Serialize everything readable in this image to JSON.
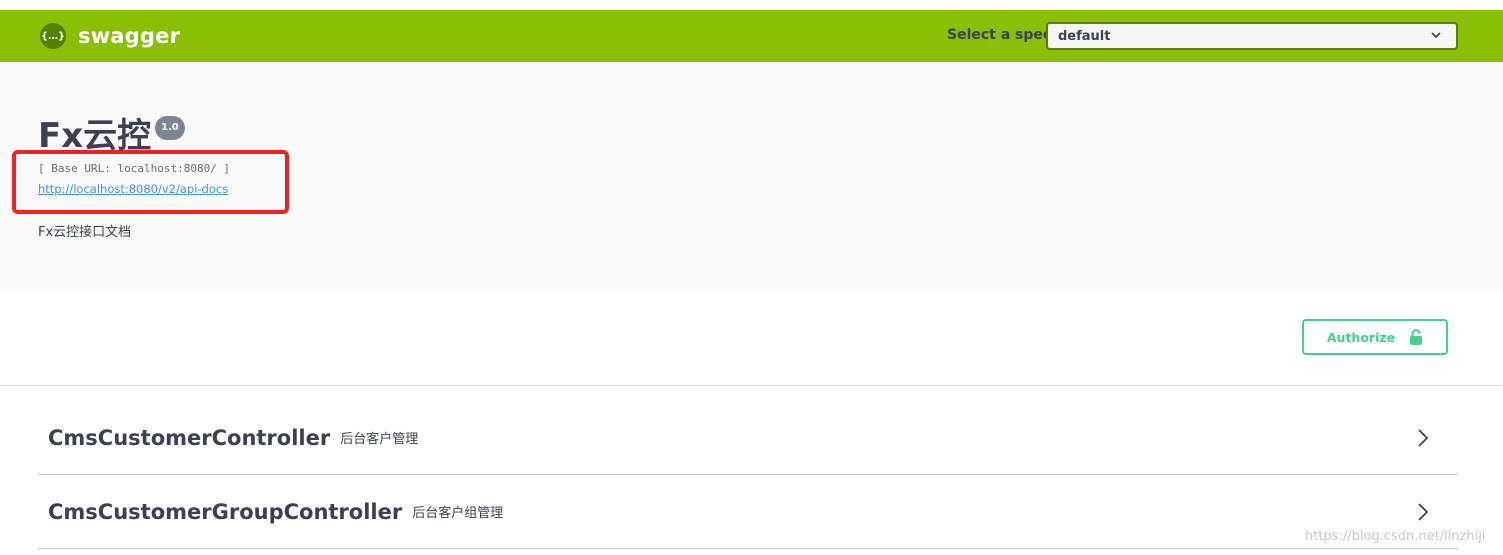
{
  "topbar": {
    "brand": "swagger",
    "logo_glyph": "{…}",
    "spec_label": "Select a spec",
    "spec_value": "default"
  },
  "info": {
    "title": "Fx云控",
    "version": "1.0",
    "base_url": "[ Base URL: localhost:8080/ ]",
    "docs_link": "http://localhost:8080/v2/api-docs",
    "description": "Fx云控接口文档"
  },
  "authorize": {
    "label": "Authorize"
  },
  "tags": [
    {
      "name": "CmsCustomerController",
      "description": "后台客户管理"
    },
    {
      "name": "CmsCustomerGroupController",
      "description": "后台客户组管理"
    }
  ],
  "watermark": "https://blog.csdn.net/linzhiji",
  "colors": {
    "topbar": "#89bf04",
    "authorize": "#49cc90",
    "link": "#4990e2",
    "highlight": "#ee2222"
  }
}
